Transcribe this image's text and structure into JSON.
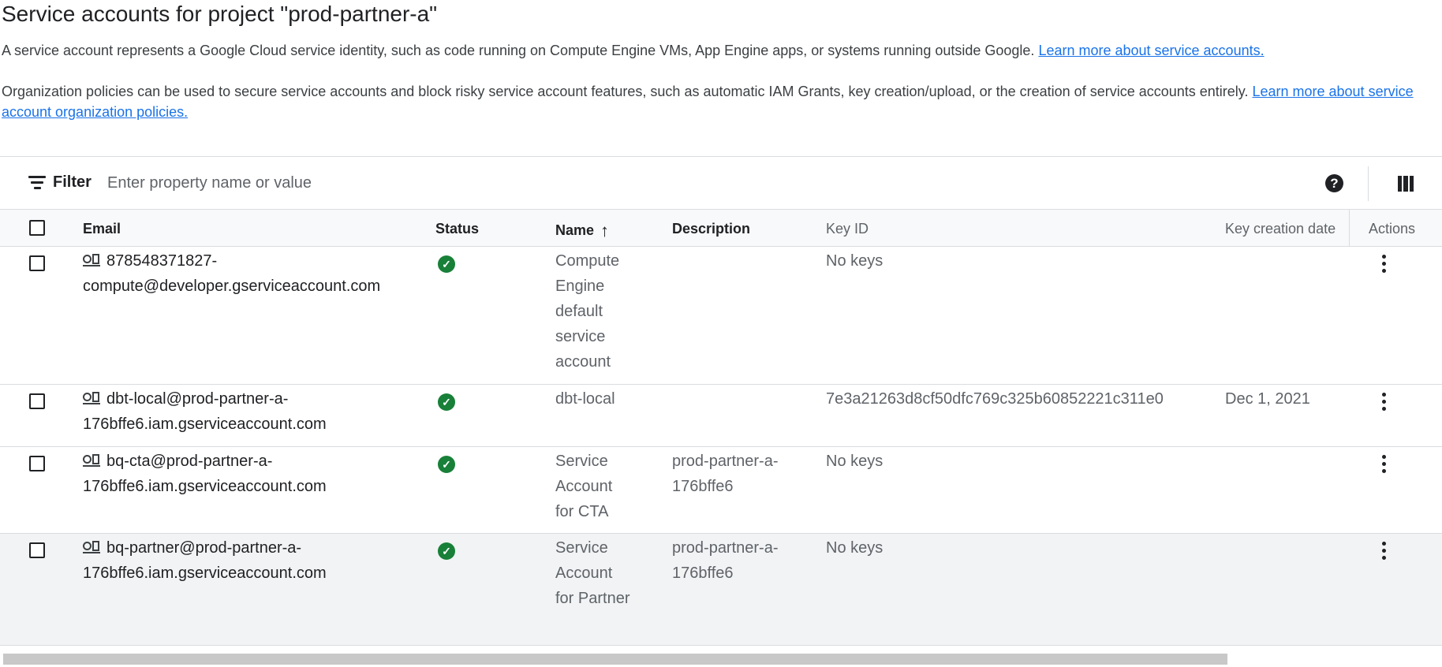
{
  "page": {
    "title": "Service accounts for project \"prod-partner-a\"",
    "intro_text": "A service account represents a Google Cloud service identity, such as code running on Compute Engine VMs, App Engine apps, or systems running outside Google.",
    "intro_link": "Learn more about service accounts.",
    "policy_text": "Organization policies can be used to secure service accounts and block risky service account features, such as automatic IAM Grants, key creation/upload, or the creation of service accounts entirely.",
    "policy_link": "Learn more about service account organization policies."
  },
  "filter": {
    "label": "Filter",
    "placeholder": "Enter property name or value",
    "help_icon": "help-icon",
    "columns_icon": "column-display-icon"
  },
  "table": {
    "columns": {
      "email": "Email",
      "status": "Status",
      "name": "Name",
      "name_sort": "↑",
      "description": "Description",
      "key_id": "Key ID",
      "key_creation_date": "Key creation date",
      "actions": "Actions"
    },
    "rows": [
      {
        "email_line1": "878548371827-",
        "email_line2": "compute@developer.gserviceaccount.com",
        "status": "enabled",
        "name": "Compute Engine default service account",
        "description": "",
        "key_id": "No keys",
        "key_creation_date": ""
      },
      {
        "email_line1": "dbt-local@prod-partner-a-",
        "email_line2": "176bffe6.iam.gserviceaccount.com",
        "status": "enabled",
        "name": "dbt-local",
        "description": "",
        "key_id": "7e3a21263d8cf50dfc769c325b60852221c311e0",
        "key_creation_date": "Dec 1, 2021"
      },
      {
        "email_line1": "bq-cta@prod-partner-a-",
        "email_line2": "176bffe6.iam.gserviceaccount.com",
        "status": "enabled",
        "name": "Service Account for CTA",
        "description": "prod-partner-a-176bffe6",
        "key_id": "No keys",
        "key_creation_date": ""
      },
      {
        "email_line1": "bq-partner@prod-partner-a-",
        "email_line2": "176bffe6.iam.gserviceaccount.com",
        "status": "enabled",
        "name": "Service Account for Partner",
        "description": "prod-partner-a-176bffe6",
        "key_id": "No keys",
        "key_creation_date": ""
      }
    ]
  },
  "colors": {
    "link": "#1a73e8",
    "status_ok": "#188038"
  }
}
